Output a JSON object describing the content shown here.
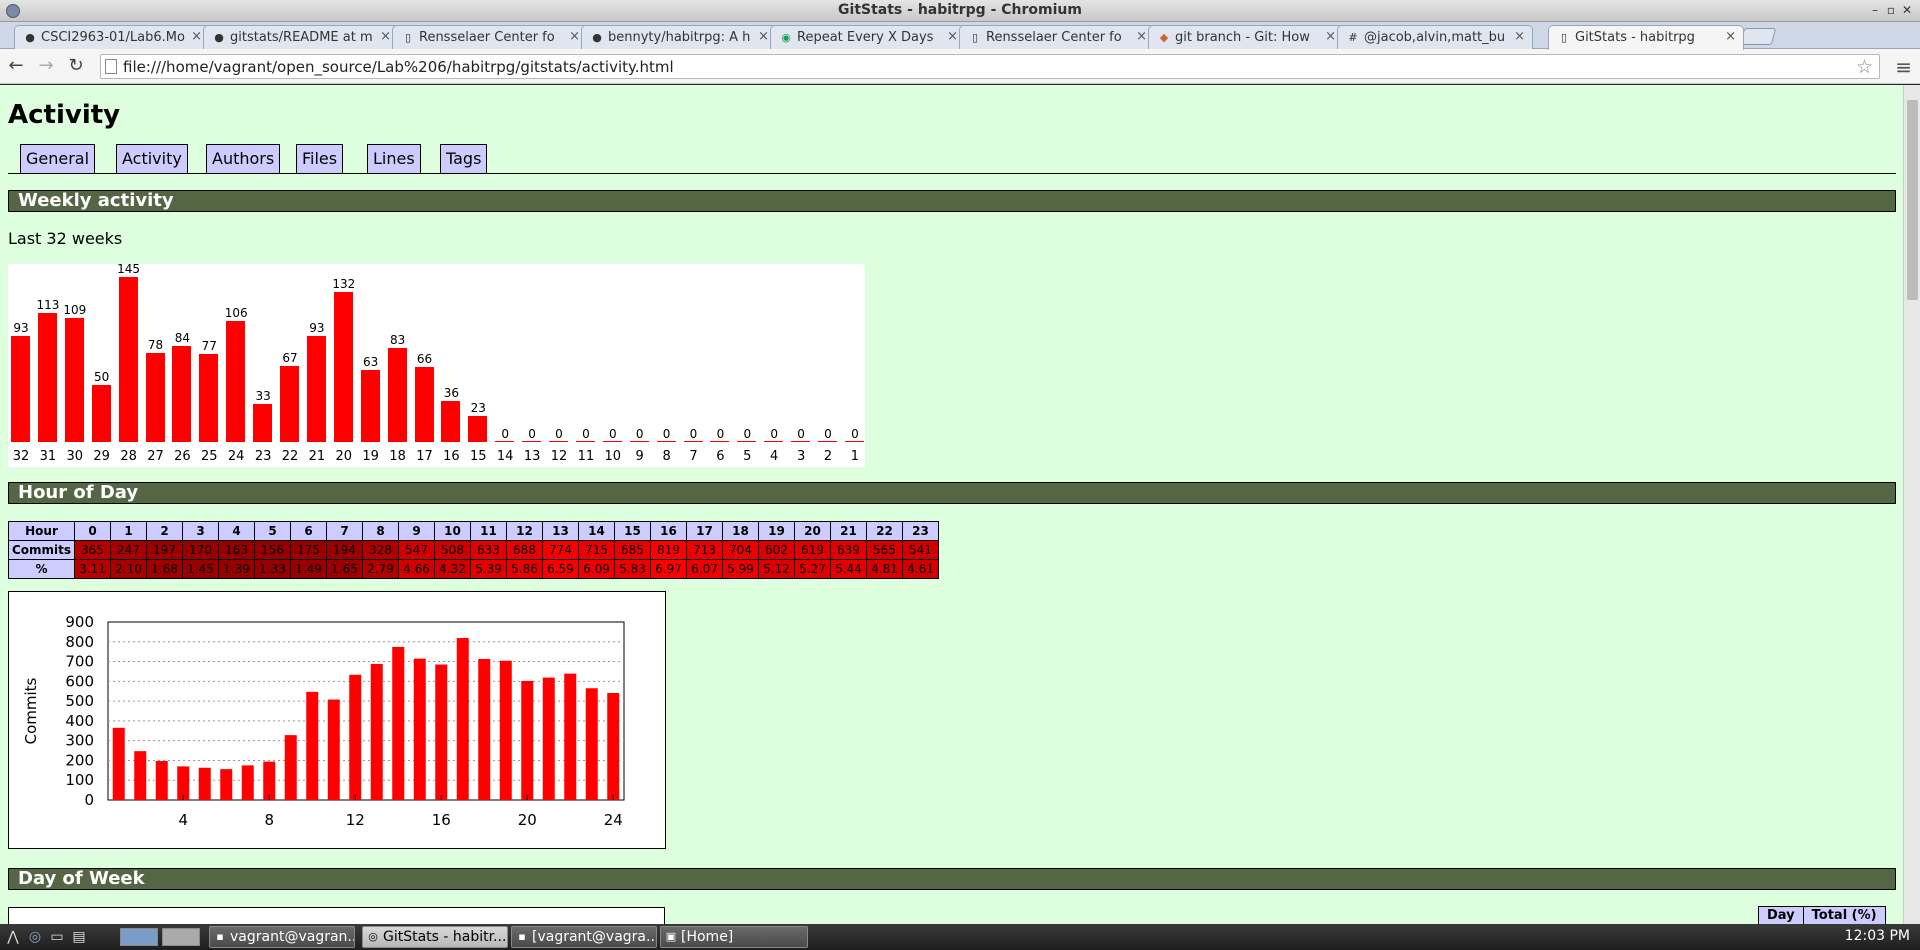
{
  "window": {
    "title": "GitStats - habitrpg - Chromium"
  },
  "tabs": [
    {
      "label": "CSCI2963-01/Lab6.Mo",
      "icon": "github-icon"
    },
    {
      "label": "gitstats/README at m",
      "icon": "github-icon"
    },
    {
      "label": "Rensselaer Center fo",
      "icon": "page-icon"
    },
    {
      "label": "bennyty/habitrpg: A h",
      "icon": "github-icon"
    },
    {
      "label": "Repeat Every X Days",
      "icon": "habitrpg-icon"
    },
    {
      "label": "Rensselaer Center fo",
      "icon": "page-icon"
    },
    {
      "label": "git branch - Git: How",
      "icon": "git-icon"
    },
    {
      "label": "@jacob,alvin,matt_bu",
      "icon": "hash-icon"
    },
    {
      "label": "GitStats - habitrpg",
      "icon": "page-icon"
    }
  ],
  "toolbar": {
    "url": "file:///home/vagrant/open_source/Lab%206/habitrpg/gitstats/activity.html"
  },
  "page": {
    "title": "Activity",
    "nav": [
      "General",
      "Activity",
      "Authors",
      "Files",
      "Lines",
      "Tags"
    ],
    "weekly_heading": "Weekly activity",
    "weekly_subtitle": "Last 32 weeks",
    "hour_heading": "Hour of Day",
    "dow_heading": "Day of Week",
    "hour_table": {
      "row_labels": [
        "Hour",
        "Commits",
        "%"
      ],
      "hours": [
        "0",
        "1",
        "2",
        "3",
        "4",
        "5",
        "6",
        "7",
        "8",
        "9",
        "10",
        "11",
        "12",
        "13",
        "14",
        "15",
        "16",
        "17",
        "18",
        "19",
        "20",
        "21",
        "22",
        "23"
      ],
      "commits": [
        "365",
        "247",
        "197",
        "170",
        "163",
        "156",
        "175",
        "194",
        "328",
        "547",
        "508",
        "633",
        "688",
        "774",
        "715",
        "685",
        "819",
        "713",
        "704",
        "602",
        "619",
        "639",
        "565",
        "541"
      ],
      "percent": [
        "3.11",
        "2.10",
        "1.68",
        "1.45",
        "1.39",
        "1.33",
        "1.49",
        "1.65",
        "2.79",
        "4.66",
        "4.32",
        "5.39",
        "5.86",
        "6.59",
        "6.09",
        "5.83",
        "6.97",
        "6.07",
        "5.99",
        "5.12",
        "5.27",
        "5.44",
        "4.81",
        "4.61"
      ]
    },
    "day_table_headers": [
      "Day",
      "Total (%)"
    ]
  },
  "chart_data": [
    {
      "type": "bar",
      "categories": [
        "32",
        "31",
        "30",
        "29",
        "28",
        "27",
        "26",
        "25",
        "24",
        "23",
        "22",
        "21",
        "20",
        "19",
        "18",
        "17",
        "16",
        "15",
        "14",
        "13",
        "12",
        "11",
        "10",
        "9",
        "8",
        "7",
        "6",
        "5",
        "4",
        "3",
        "2",
        "1"
      ],
      "values": [
        93,
        113,
        109,
        50,
        145,
        78,
        84,
        77,
        106,
        33,
        67,
        93,
        132,
        63,
        83,
        66,
        36,
        23,
        0,
        0,
        0,
        0,
        0,
        0,
        0,
        0,
        0,
        0,
        0,
        0,
        0,
        0
      ],
      "title": "",
      "color": "#ff0000"
    },
    {
      "type": "bar",
      "x": [
        1,
        2,
        3,
        4,
        5,
        6,
        7,
        8,
        9,
        10,
        11,
        12,
        13,
        14,
        15,
        16,
        17,
        18,
        19,
        20,
        21,
        22,
        23,
        24
      ],
      "values": [
        365,
        247,
        197,
        170,
        163,
        156,
        175,
        194,
        328,
        547,
        508,
        633,
        688,
        774,
        715,
        685,
        819,
        713,
        704,
        602,
        619,
        639,
        565,
        541
      ],
      "ylabel": "Commits",
      "ylim": [
        0,
        900
      ],
      "yticks": [
        "0",
        "100",
        "200",
        "300",
        "400",
        "500",
        "600",
        "700",
        "800",
        "900"
      ],
      "xticks": [
        "4",
        "8",
        "12",
        "16",
        "20",
        "24"
      ],
      "grid": true,
      "color": "#ff0000"
    }
  ],
  "taskbar": {
    "buttons": [
      "vagrant@vagran...",
      "GitStats - habitr...",
      "[vagrant@vagra...",
      "[Home]"
    ],
    "clock": "12:03 PM"
  }
}
